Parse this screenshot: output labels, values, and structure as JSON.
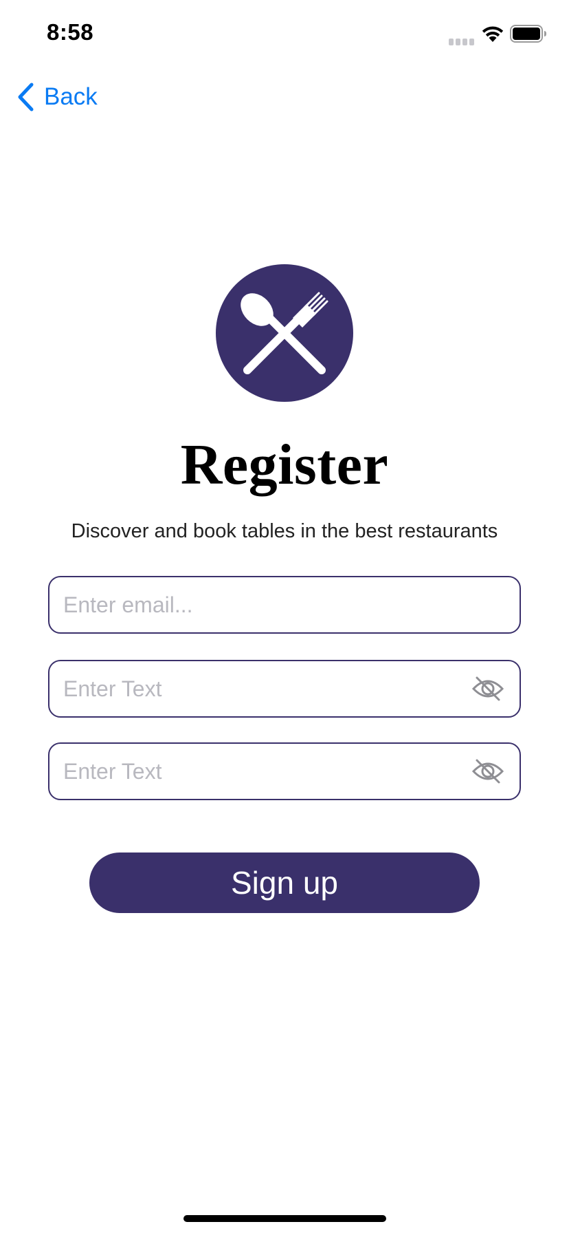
{
  "status_bar": {
    "time": "8:58",
    "signal_icon": "cellular-signal-icon",
    "wifi_icon": "wifi-icon",
    "battery_icon": "battery-icon"
  },
  "nav": {
    "back_label": "Back",
    "back_icon": "chevron-left-icon"
  },
  "logo": {
    "icon": "spoon-fork-crossed-icon",
    "background_color": "#3a306b"
  },
  "title": "Register",
  "subtitle": "Discover and book tables in the best restaurants",
  "form": {
    "email_placeholder": "Enter email...",
    "password_placeholder": "Enter Text",
    "confirm_placeholder": "Enter Text",
    "password_toggle_icon": "eye-slash-icon"
  },
  "signup_label": "Sign up",
  "colors": {
    "accent": "#3a306b",
    "link": "#0a7bf3",
    "placeholder": "#b8b8bf"
  }
}
